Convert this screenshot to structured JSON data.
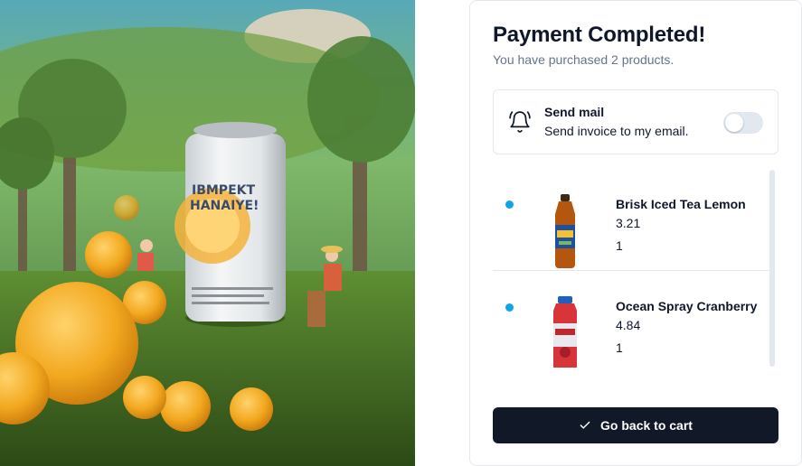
{
  "hero": {
    "can_text_line1": "IBMPEKT",
    "can_text_line2": "HANAIYE!"
  },
  "header": {
    "title": "Payment Completed!",
    "subtitle": "You have purchased 2 products."
  },
  "notification": {
    "icon": "bell-icon",
    "title": "Send mail",
    "description": "Send invoice to my email.",
    "toggle_on": false
  },
  "products": [
    {
      "name": "Brisk Iced Tea Lemon",
      "price": "3.21",
      "quantity": "1",
      "status_color": "#0ea5e9"
    },
    {
      "name": "Ocean Spray Cranberry",
      "price": "4.84",
      "quantity": "1",
      "status_color": "#0ea5e9"
    }
  ],
  "actions": {
    "back_to_cart": "Go back to cart",
    "back_to_cart_icon": "check-icon"
  },
  "colors": {
    "primary": "#111827",
    "accent": "#0ea5e9",
    "muted": "#64748b"
  }
}
